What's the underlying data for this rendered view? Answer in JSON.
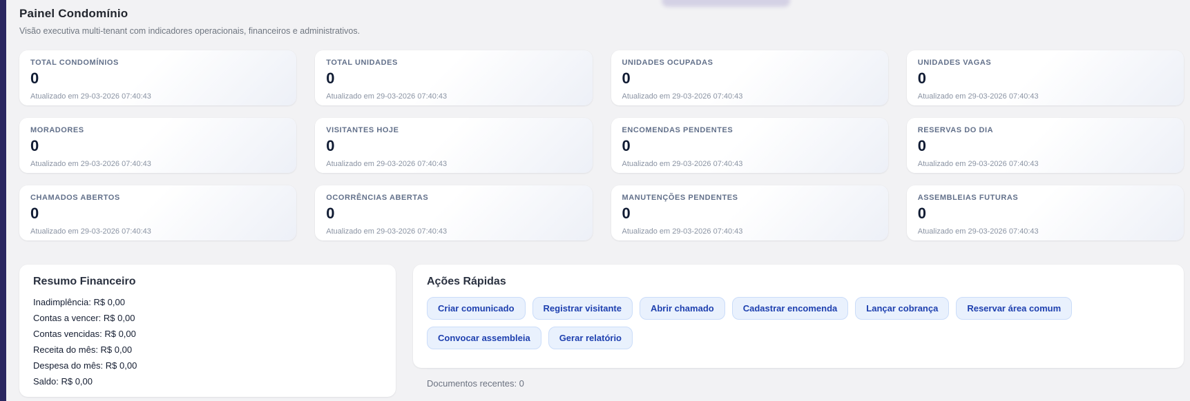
{
  "page": {
    "title": "Painel Condomínio",
    "subtitle": "Visão executiva multi-tenant com indicadores operacionais, financeiros e administrativos."
  },
  "colors": {
    "side_strip": "#2a2760",
    "stat_label": "#62708a",
    "stat_value": "#101b33",
    "action_button_bg": "#e9f1fd",
    "action_button_border": "#cadcf9",
    "action_button_text": "#1e40af",
    "page_background": "#f2f2f4"
  },
  "stats": {
    "cards": [
      {
        "label": "TOTAL CONDOMÍNIOS",
        "value": "0",
        "updated": "Atualizado em 29-03-2026 07:40:43"
      },
      {
        "label": "TOTAL UNIDADES",
        "value": "0",
        "updated": "Atualizado em 29-03-2026 07:40:43"
      },
      {
        "label": "UNIDADES OCUPADAS",
        "value": "0",
        "updated": "Atualizado em 29-03-2026 07:40:43"
      },
      {
        "label": "UNIDADES VAGAS",
        "value": "0",
        "updated": "Atualizado em 29-03-2026 07:40:43"
      },
      {
        "label": "MORADORES",
        "value": "0",
        "updated": "Atualizado em 29-03-2026 07:40:43"
      },
      {
        "label": "VISITANTES HOJE",
        "value": "0",
        "updated": "Atualizado em 29-03-2026 07:40:43"
      },
      {
        "label": "ENCOMENDAS PENDENTES",
        "value": "0",
        "updated": "Atualizado em 29-03-2026 07:40:43"
      },
      {
        "label": "RESERVAS DO DIA",
        "value": "0",
        "updated": "Atualizado em 29-03-2026 07:40:43"
      },
      {
        "label": "CHAMADOS ABERTOS",
        "value": "0",
        "updated": "Atualizado em 29-03-2026 07:40:43"
      },
      {
        "label": "OCORRÊNCIAS ABERTAS",
        "value": "0",
        "updated": "Atualizado em 29-03-2026 07:40:43"
      },
      {
        "label": "MANUTENÇÕES PENDENTES",
        "value": "0",
        "updated": "Atualizado em 29-03-2026 07:40:43"
      },
      {
        "label": "ASSEMBLEIAS FUTURAS",
        "value": "0",
        "updated": "Atualizado em 29-03-2026 07:40:43"
      }
    ]
  },
  "financial_summary": {
    "title": "Resumo Financeiro",
    "items": [
      {
        "text": "Inadimplência: R$ 0,00"
      },
      {
        "text": "Contas a vencer: R$ 0,00"
      },
      {
        "text": "Contas vencidas: R$ 0,00"
      },
      {
        "text": "Receita do mês: R$ 0,00"
      },
      {
        "text": "Despesa do mês: R$ 0,00"
      },
      {
        "text": "Saldo: R$ 0,00"
      }
    ]
  },
  "quick_actions": {
    "title": "Ações Rápidas",
    "buttons": [
      {
        "label": "Criar comunicado"
      },
      {
        "label": "Registrar visitante"
      },
      {
        "label": "Abrir chamado"
      },
      {
        "label": "Cadastrar encomenda"
      },
      {
        "label": "Lançar cobrança"
      },
      {
        "label": "Reservar área comum"
      },
      {
        "label": "Convocar assembleia"
      },
      {
        "label": "Gerar relatório"
      }
    ],
    "recent_documents": "Documentos recentes: 0"
  }
}
